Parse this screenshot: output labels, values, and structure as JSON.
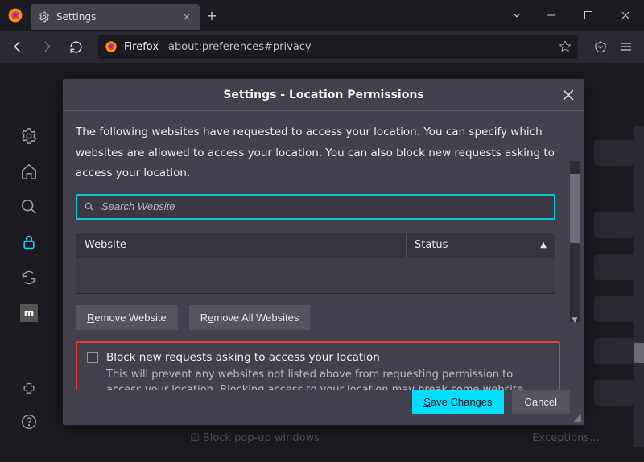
{
  "tab": {
    "title": "Settings"
  },
  "urlbar": {
    "identity": "Firefox",
    "url": "about:preferences#privacy"
  },
  "dialog": {
    "title": "Settings - Location Permissions",
    "description": "The following websites have requested to access your location. You can specify which websites are allowed to access your location. You can also block new requests asking to access your location.",
    "search_placeholder": "Search Website",
    "columns": {
      "website": "Website",
      "status": "Status"
    },
    "remove_website": "Remove Website",
    "remove_all": "Remove All Websites",
    "block_label": "Block new requests asking to access your location",
    "block_desc": "This will prevent any websites not listed above from requesting permission to access your location. Blocking access to your location may break some website features.",
    "save": "Save Changes",
    "cancel": "Cancel"
  }
}
